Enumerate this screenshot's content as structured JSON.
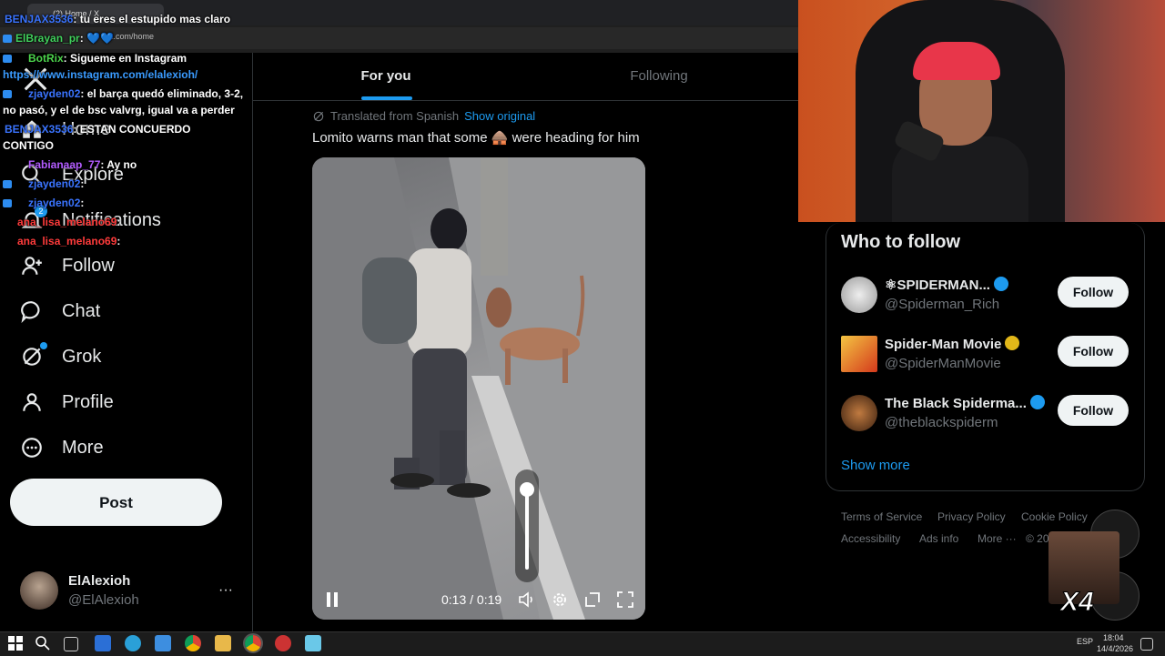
{
  "browser": {
    "tabs": [
      {
        "label": "(2) Home / X"
      }
    ],
    "address": "x.com/home"
  },
  "sidebar": {
    "nav_items": [
      {
        "label": "Home",
        "icon": "home-icon"
      },
      {
        "label": "Explore",
        "icon": "search-icon"
      },
      {
        "label": "Notifications",
        "icon": "bell-icon",
        "badge": "2"
      },
      {
        "label": "Follow",
        "icon": "person-plus-icon"
      },
      {
        "label": "Chat",
        "icon": "chat-bubble-icon"
      },
      {
        "label": "Grok",
        "icon": "grok-icon"
      },
      {
        "label": "Profile",
        "icon": "person-icon"
      },
      {
        "label": "More",
        "icon": "more-circle-icon"
      }
    ],
    "post_label": "Post",
    "user": {
      "name": "ElAlexioh",
      "handle": "@ElAlexioh",
      "menu": "···"
    }
  },
  "timeline": {
    "tabs": [
      {
        "label": "For you",
        "active": true
      },
      {
        "label": "Following",
        "active": false
      }
    ],
    "post": {
      "translated_label": "Translated from Spanish",
      "show_original": "Show original",
      "text": "Lomito warns man that some 🛖 were heading for him",
      "video": {
        "time": "0:13 / 0:19",
        "volume": 1.0,
        "playing": true
      }
    }
  },
  "who_to_follow": {
    "title": "Who to follow",
    "accounts": [
      {
        "name": "⚛SPIDERMAN...",
        "handle": "@Spiderman_Rich",
        "verified": "blue",
        "follow_label": "Follow"
      },
      {
        "name": "Spider-Man Movie",
        "handle": "@SpiderManMovie",
        "verified": "gold",
        "follow_label": "Follow"
      },
      {
        "name": "The Black Spiderma...",
        "handle": "@theblackspiderm",
        "verified": "blue",
        "follow_label": "Follow"
      }
    ],
    "show_more": "Show more"
  },
  "footer": {
    "links": [
      "Terms of Service",
      "Privacy Policy",
      "Cookie Policy",
      "Accessibility",
      "Ads info",
      "More ···",
      "© 20"
    ]
  },
  "stream_overlay": {
    "chat": [
      {
        "user": "BENJAX3536",
        "message": ": tu eres el estupido mas claro",
        "user_color": "#3a74ff"
      },
      {
        "user": "ElBrayan_pr",
        "message": ": 💙💙",
        "user_color": "#41d15d"
      },
      {
        "user": "BotRix",
        "message": ": Sigueme en Instagram",
        "user_color": "#4cd54c"
      },
      {
        "user": "",
        "message": "https://www.instagram.com/elalexioh/",
        "user_color": "#3a9bff"
      },
      {
        "user": "zjayden02",
        "message": ": el barça quedó eliminado, 3-2,",
        "user_color": "#3a74ff"
      },
      {
        "user": "",
        "message": "no pasó, y el de bsc valvrg, igual va a perder",
        "user_color": "#fff"
      },
      {
        "user": "BENJAX3536",
        "message": ": ESTAN CONCUERDO",
        "user_color": "#3a74ff"
      },
      {
        "user": "",
        "message": "CONTIGO",
        "user_color": "#fff"
      },
      {
        "user": "Fabianaap_77",
        "message": ": Ay no",
        "user_color": "#b35cff"
      },
      {
        "user": "zjayden02",
        "message": ":",
        "user_color": "#3a74ff"
      },
      {
        "user": "zjayden02",
        "message": ":",
        "user_color": "#3a74ff"
      },
      {
        "user": "ana_lisa_melano69",
        "message": ":",
        "user_color": "#ff3b3b"
      },
      {
        "user": "ana_lisa_melano69",
        "message": ":",
        "user_color": "#ff3b3b"
      }
    ],
    "meme_text": "X4"
  },
  "taskbar": {
    "language": "ESP",
    "time": "18:04",
    "date": "14/4/2026"
  },
  "colors": {
    "accent": "#1d9bf0",
    "background": "#000000",
    "border": "#2f3336",
    "muted": "#71767b"
  }
}
